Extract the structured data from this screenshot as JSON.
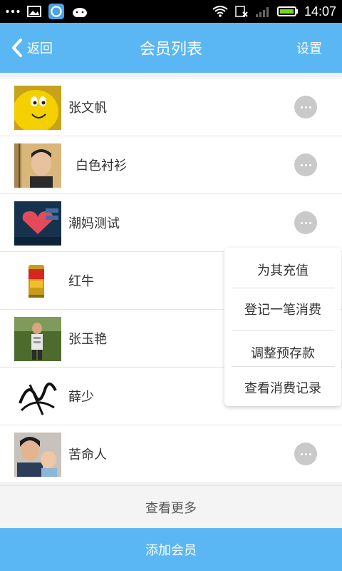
{
  "status_bar": {
    "time": "14:07",
    "icons": [
      "more-dots-icon",
      "image-icon",
      "browser-icon",
      "android-icon",
      "wifi-icon",
      "no-sim-icon",
      "signal-icon",
      "battery-icon"
    ]
  },
  "header": {
    "back_label": "返回",
    "title": "会员列表",
    "settings_label": "设置"
  },
  "members": [
    {
      "name": "张文帆",
      "avatar": "yellow-character-avatar"
    },
    {
      "name": "白色衬衫",
      "avatar": "young-man-avatar"
    },
    {
      "name": "潮妈测试",
      "avatar": "heart-graphic-avatar"
    },
    {
      "name": "红牛",
      "avatar": "red-bull-can-avatar"
    },
    {
      "name": "张玉艳",
      "avatar": "child-outdoor-avatar"
    },
    {
      "name": "薛少",
      "avatar": "signature-avatar"
    },
    {
      "name": "苦命人",
      "avatar": "parent-child-avatar"
    }
  ],
  "popup_menu": {
    "items": [
      "为其充值",
      "登记一笔消费",
      "调整预存款",
      "查看消费记录"
    ]
  },
  "footer": {
    "load_more": "查看更多",
    "add_member": "添加会员"
  },
  "colors": {
    "accent": "#5ab7f3",
    "more_button": "#c9c9c9"
  }
}
